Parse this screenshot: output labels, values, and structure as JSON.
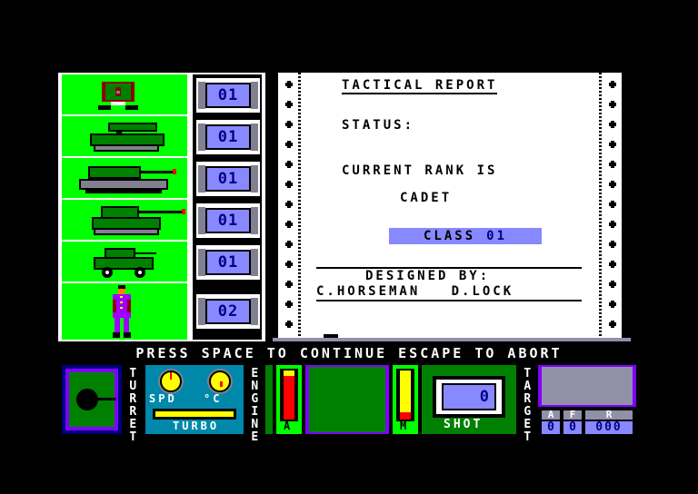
{
  "units": [
    {
      "name": "command-bunker",
      "count": "01"
    },
    {
      "name": "missile-tank",
      "count": "01"
    },
    {
      "name": "heavy-tank",
      "count": "01"
    },
    {
      "name": "medium-tank",
      "count": "01"
    },
    {
      "name": "armored-car",
      "count": "01"
    },
    {
      "name": "soldier",
      "count": "02"
    }
  ],
  "report": {
    "title": "TACTICAL REPORT",
    "status_label": "STATUS:",
    "rank_label": "CURRENT RANK IS",
    "rank": "CADET",
    "class_label": "CLASS",
    "class_value": "01",
    "designed_by": "DESIGNED BY:",
    "authors": "C.HORSEMAN   D.LOCK"
  },
  "prompt": "PRESS SPACE TO CONTINUE ESCAPE TO ABORT",
  "hud": {
    "turret_label": "TURRET",
    "speed_label": "SPD",
    "temp_label": "°C",
    "turbo_label": "TURBO",
    "engine_label": "ENGINE",
    "gauge_a_label": "A",
    "gauge_m_label": "M",
    "gauge_a_level": 0.88,
    "gauge_m_red_fraction": 0.15,
    "shot_label": "SHOT",
    "shot_count": "0",
    "target_label": "TARGET",
    "a_label": "A",
    "f_label": "F",
    "r_label": "R",
    "a_value": "0",
    "f_value": "0",
    "r_value": "000",
    "colors": {
      "panel_green": "#00ff00",
      "badge_blue": "#8888ff",
      "dark_green": "#008000",
      "purple": "#8000ff",
      "dash_teal": "#0088aa",
      "yellow": "#ffff00",
      "red": "#ff0000"
    }
  }
}
